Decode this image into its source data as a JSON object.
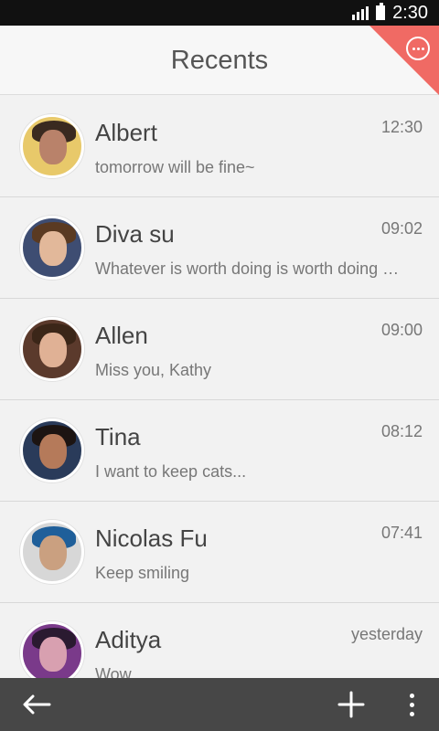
{
  "status_bar": {
    "time": "2:30",
    "icons": [
      "signal-icon",
      "battery-icon"
    ]
  },
  "header": {
    "title": "Recents",
    "corner_icon": "more-circle-icon",
    "corner_color": "#f06a64"
  },
  "conversations": [
    {
      "name": "Albert",
      "message": "tomorrow will be fine~",
      "time": "12:30",
      "avatar": {
        "bg": "#e8c96a",
        "face": "#b9826a",
        "hair": "#3a2a20"
      }
    },
    {
      "name": "Diva su",
      "message": "Whatever is worth doing is worth doing well",
      "time": "09:02",
      "avatar": {
        "bg": "#3e4d72",
        "face": "#e2b89a",
        "hair": "#5a3a22"
      }
    },
    {
      "name": "Allen",
      "message": "Miss you, Kathy",
      "time": "09:00",
      "avatar": {
        "bg": "#5b3a2c",
        "face": "#e0b195",
        "hair": "#3b2618"
      }
    },
    {
      "name": "Tina",
      "message": "I want to keep cats...",
      "time": "08:12",
      "avatar": {
        "bg": "#2a3b5a",
        "face": "#b57a5a",
        "hair": "#1c1412"
      }
    },
    {
      "name": "Nicolas Fu",
      "message": "Keep smiling",
      "time": "07:41",
      "avatar": {
        "bg": "#d7d7d7",
        "face": "#caa080",
        "hair": "#1f5f9a"
      }
    },
    {
      "name": "Aditya",
      "message": "Wow",
      "time": "yesterday",
      "avatar": {
        "bg": "#7a3a8a",
        "face": "#d8a0b0",
        "hair": "#2a1a30"
      }
    }
  ],
  "bottom_bar": {
    "icons": [
      "back-arrow-icon",
      "plus-icon",
      "overflow-menu-icon"
    ],
    "bg": "#474747"
  }
}
